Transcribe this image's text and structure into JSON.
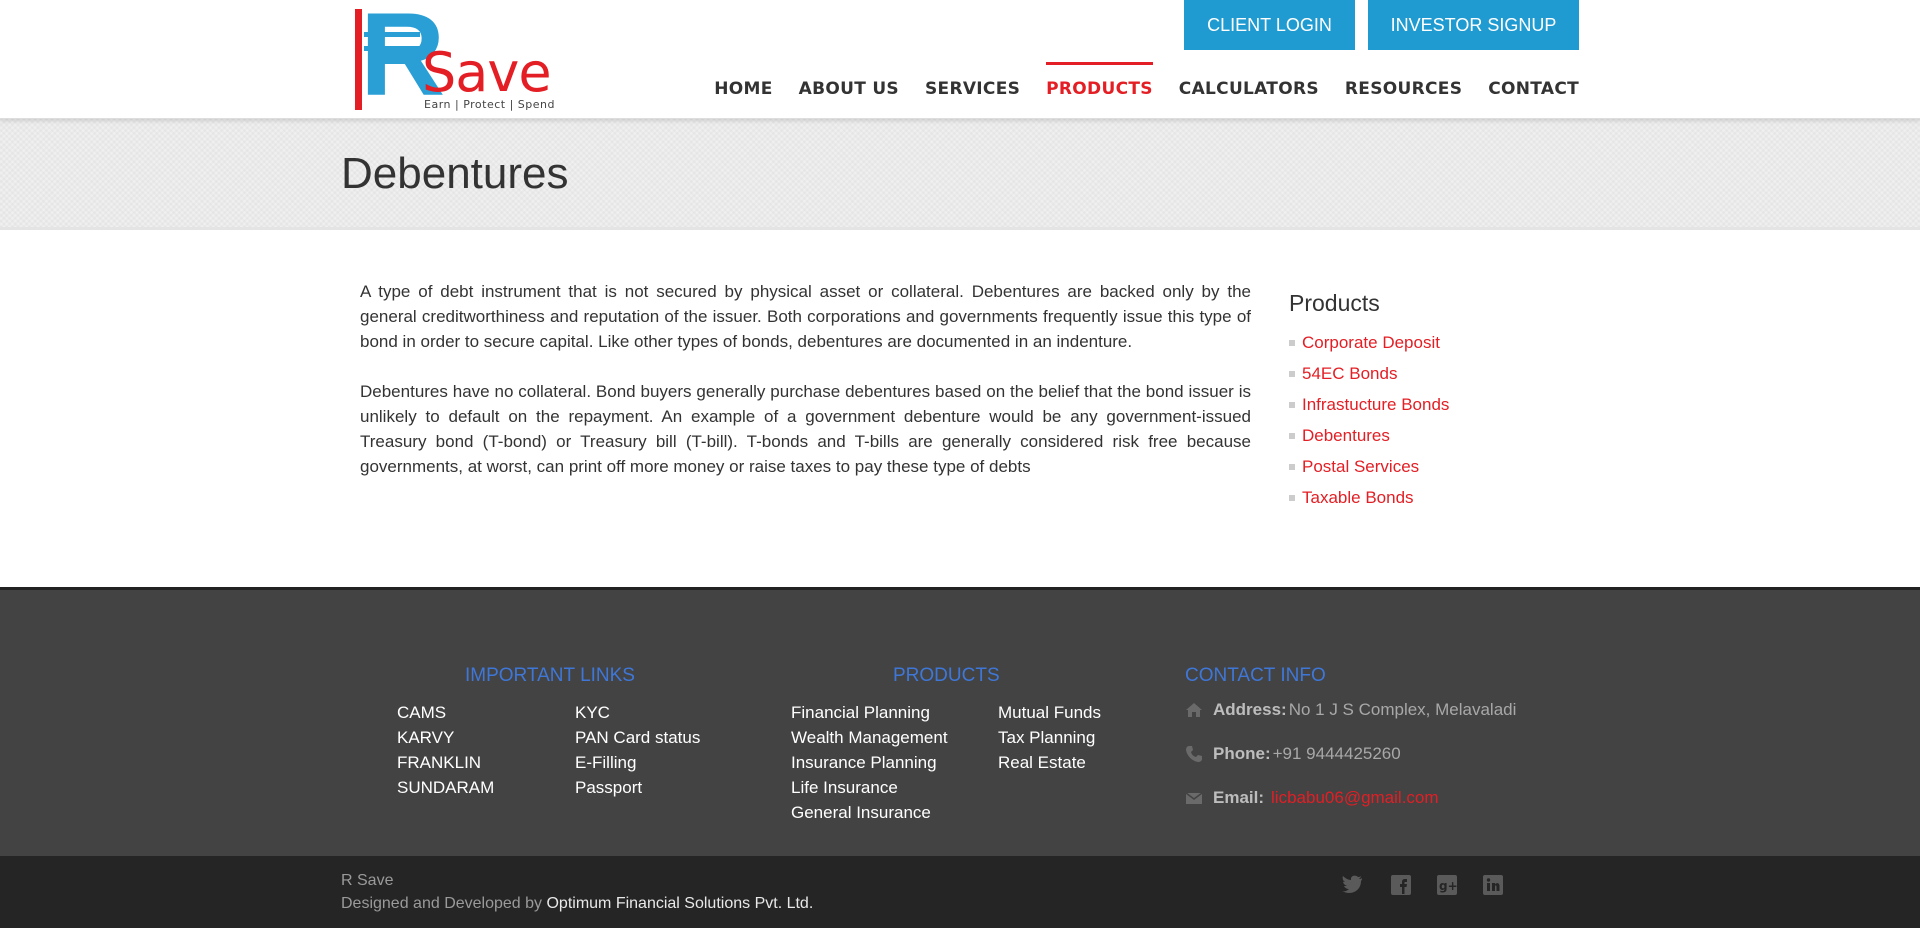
{
  "header": {
    "logo": {
      "letter": "R",
      "word": "Save",
      "tagline": "Earn  |  Protect  |  Spend"
    },
    "buttons": {
      "client_login": "CLIENT LOGIN",
      "investor_signup": "INVESTOR SIGNUP"
    },
    "nav": [
      {
        "label": "HOME",
        "active": false
      },
      {
        "label": "ABOUT US",
        "active": false
      },
      {
        "label": "SERVICES",
        "active": false
      },
      {
        "label": "PRODUCTS",
        "active": true
      },
      {
        "label": "CALCULATORS",
        "active": false
      },
      {
        "label": "RESOURCES",
        "active": false
      },
      {
        "label": "CONTACT",
        "active": false
      }
    ]
  },
  "page": {
    "title": "Debentures"
  },
  "content": {
    "paragraphs": [
      "A type of debt instrument that is not secured by physical asset or collateral. Debentures are backed only by the general creditworthiness and reputation of the issuer. Both corporations and governments frequently issue this type of bond in order to secure capital. Like other types of bonds, debentures are documented in an indenture.",
      "Debentures have no collateral. Bond buyers generally purchase debentures based on the belief that the bond issuer is unlikely to default on the repayment. An example of a government debenture would be any government-issued Treasury bond (T-bond) or Treasury bill (T-bill). T-bonds and T-bills are generally considered risk free because governments, at worst, can print off more money or raise taxes to pay these type of debts"
    ]
  },
  "sidebar": {
    "title": "Products",
    "items": [
      "Corporate Deposit",
      "54EC Bonds",
      "Infrastucture Bonds",
      "Debentures",
      "Postal Services",
      "Taxable Bonds"
    ]
  },
  "footer": {
    "important_links": {
      "heading": "IMPORTANT LINKS",
      "col1": [
        "CAMS",
        "KARVY",
        "FRANKLIN",
        "SUNDARAM"
      ],
      "col2": [
        "KYC",
        "PAN Card status",
        "E-Filling",
        "Passport"
      ]
    },
    "products": {
      "heading": "PRODUCTS",
      "col1": [
        "Financial Planning",
        "Wealth Management",
        "Insurance Planning",
        "Life Insurance",
        "General Insurance"
      ],
      "col2": [
        "Mutual Funds",
        "Tax Planning",
        "Real Estate"
      ]
    },
    "contact": {
      "heading": "CONTACT INFO",
      "address_label": "Address:",
      "address": "No 1 J S Complex, Melavaladi",
      "phone_label": "Phone:",
      "phone": "+91 9444425260",
      "email_label": "Email:",
      "email": "licbabu06@gmail.com"
    }
  },
  "bottom": {
    "brand": "R Save",
    "credit_prefix": "Designed and Developed by ",
    "credit_link": "Optimum Financial Solutions Pvt. Ltd.",
    "social": [
      "twitter-icon",
      "facebook-icon",
      "google-plus-icon",
      "linkedin-icon"
    ]
  },
  "colors": {
    "brand_red": "#e31e24",
    "brand_blue": "#1f9bd1",
    "footer_heading": "#3f77d8"
  }
}
